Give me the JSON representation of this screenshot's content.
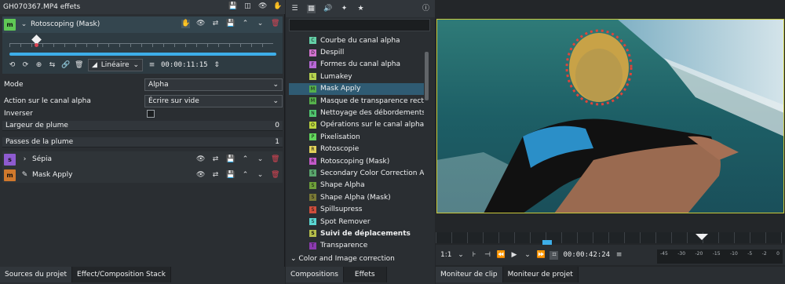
{
  "left_panel": {
    "title": "GH070367.MP4 effets",
    "effect_main": {
      "badge": "m",
      "name": "Rotoscoping (Mask)"
    },
    "interp": "Linéaire",
    "timecode": "00:00:11:15",
    "params": [
      {
        "label": "Mode",
        "value": "Alpha"
      },
      {
        "label": "Action sur le canal alpha",
        "value": "Écrire sur vide"
      }
    ],
    "invert_label": "Inverser",
    "sliders": [
      {
        "label": "Largeur de plume",
        "value": "0"
      },
      {
        "label": "Passes de la plume",
        "value": "1"
      }
    ],
    "sub_effects": [
      {
        "badge": "s",
        "name": "Sépia",
        "color": "#8e5bd0"
      },
      {
        "badge": "m",
        "name": "Mask Apply",
        "color": "#d0782c"
      }
    ]
  },
  "bottom_tabs_left": [
    "Sources du projet",
    "Effect/Composition Stack"
  ],
  "bottom_tabs_mid": [
    "Compositions",
    "Effets"
  ],
  "bottom_tabs_right": [
    "Moniteur de clip",
    "Moniteur de projet"
  ],
  "effects_list": [
    {
      "badge": "C",
      "name": "Courbe du canal alpha",
      "color": "#64cfa7"
    },
    {
      "badge": "D",
      "name": "Despill",
      "color": "#d373d0"
    },
    {
      "badge": "F",
      "name": "Formes du canal alpha",
      "color": "#b868d7"
    },
    {
      "badge": "L",
      "name": "Lumakey",
      "color": "#b6d24f"
    },
    {
      "badge": "M",
      "name": "Mask Apply",
      "color": "#56b04c",
      "selected": true
    },
    {
      "badge": "M",
      "name": "Masque de transparence recta",
      "color": "#56b04c"
    },
    {
      "badge": "N",
      "name": "Nettoyage des débordements",
      "color": "#51c76f"
    },
    {
      "badge": "O",
      "name": "Opérations sur le canal alpha",
      "color": "#bad63f"
    },
    {
      "badge": "P",
      "name": "Pixelisation",
      "color": "#63d65c"
    },
    {
      "badge": "R",
      "name": "Rotoscopie",
      "color": "#e1d25a"
    },
    {
      "badge": "R",
      "name": "Rotoscoping (Mask)",
      "color": "#c459c9"
    },
    {
      "badge": "S",
      "name": "Secondary Color Correction A",
      "color": "#5aa66d"
    },
    {
      "badge": "S",
      "name": "Shape Alpha",
      "color": "#6ea03a"
    },
    {
      "badge": "S",
      "name": "Shape Alpha (Mask)",
      "color": "#7a7a36"
    },
    {
      "badge": "S",
      "name": "Spillsupress",
      "color": "#cf4e3c"
    },
    {
      "badge": "S",
      "name": "Spot Remover",
      "color": "#5ad6d2"
    },
    {
      "badge": "S",
      "name": "Suivi de déplacements",
      "color": "#b5bf4b",
      "bold": true
    },
    {
      "badge": "T",
      "name": "Transparence",
      "color": "#8c3ab0"
    }
  ],
  "category_footer": "Color and Image correction",
  "monitor": {
    "zoom": "1:1",
    "timecode": "00:00:42:24",
    "meter_scale": [
      "-45",
      "-30",
      "-20",
      "-15",
      "-10",
      "-5",
      "-2",
      "0"
    ]
  },
  "colors": {
    "accent": "#3daee9",
    "selection": "#2f5b73",
    "bg": "#232629"
  }
}
